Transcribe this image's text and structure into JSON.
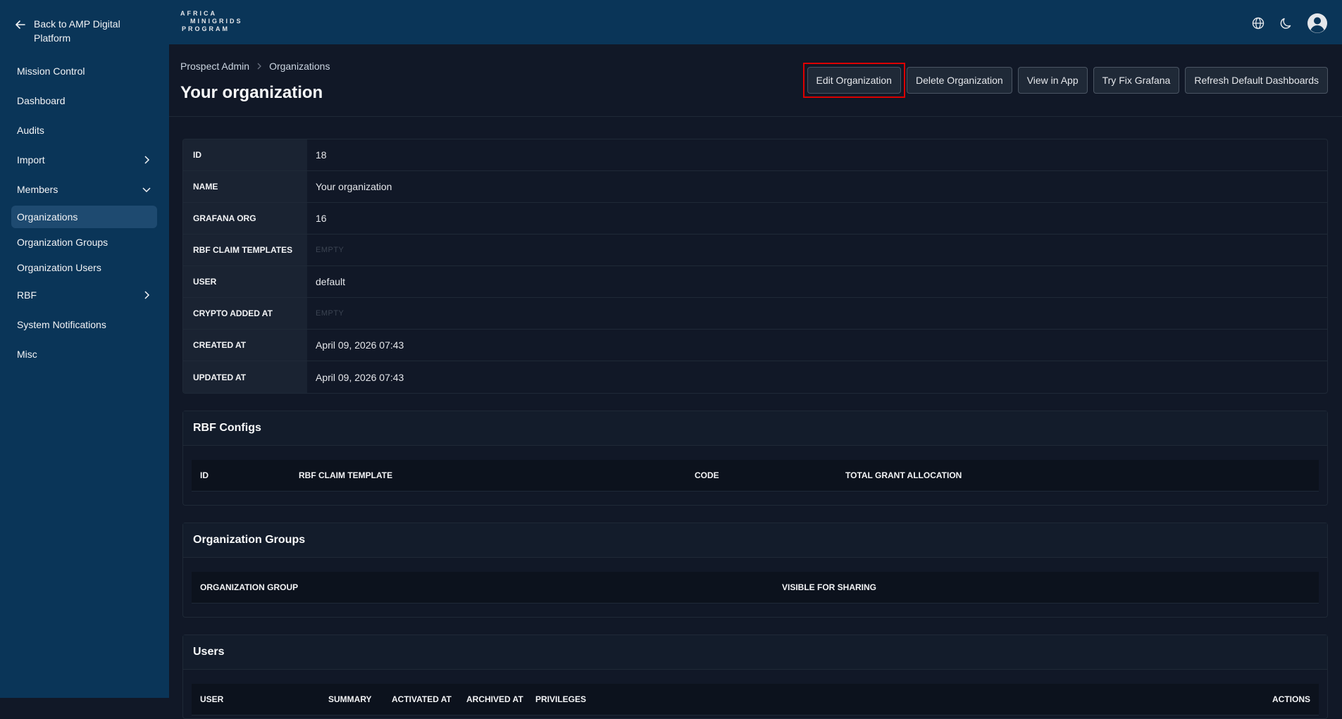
{
  "sidebar": {
    "back_label": "Back to AMP Digital Platform",
    "items": [
      {
        "label": "Mission Control",
        "chevron": "none"
      },
      {
        "label": "Dashboard",
        "chevron": "none"
      },
      {
        "label": "Audits",
        "chevron": "none"
      },
      {
        "label": "Import",
        "chevron": "right"
      },
      {
        "label": "Members",
        "chevron": "down"
      },
      {
        "label": "Organizations",
        "chevron": "none",
        "active": true
      },
      {
        "label": "Organization Groups",
        "chevron": "none"
      },
      {
        "label": "Organization Users",
        "chevron": "none"
      },
      {
        "label": "RBF",
        "chevron": "right"
      },
      {
        "label": "System Notifications",
        "chevron": "none"
      },
      {
        "label": "Misc",
        "chevron": "none"
      }
    ]
  },
  "logo": {
    "line1": "AFRICA",
    "line2": "MINIGRIDS",
    "line3": "PROGRAM"
  },
  "topbar": {
    "icons": [
      "globe-icon",
      "moon-icon",
      "user-avatar-icon"
    ]
  },
  "breadcrumb": {
    "root": "Prospect Admin",
    "current": "Organizations"
  },
  "page": {
    "title": "Your organization"
  },
  "actions": {
    "edit": "Edit Organization",
    "delete": "Delete Organization",
    "view": "View in App",
    "fix_grafana": "Try Fix Grafana",
    "refresh": "Refresh Default Dashboards"
  },
  "details": [
    {
      "key": "ID",
      "value": "18"
    },
    {
      "key": "NAME",
      "value": "Your organization"
    },
    {
      "key": "GRAFANA ORG",
      "value": "16"
    },
    {
      "key": "RBF CLAIM TEMPLATES",
      "value": "EMPTY",
      "empty": true
    },
    {
      "key": "USER",
      "value": "default"
    },
    {
      "key": "CRYPTO ADDED AT",
      "value": "EMPTY",
      "empty": true
    },
    {
      "key": "CREATED AT",
      "value": "April 09, 2026 07:43"
    },
    {
      "key": "UPDATED AT",
      "value": "April 09, 2026 07:43"
    }
  ],
  "rbf_configs": {
    "title": "RBF Configs",
    "columns": [
      "ID",
      "RBF CLAIM TEMPLATE",
      "CODE",
      "TOTAL GRANT ALLOCATION"
    ]
  },
  "org_groups": {
    "title": "Organization Groups",
    "columns": [
      "ORGANIZATION GROUP",
      "VISIBLE FOR SHARING"
    ]
  },
  "users": {
    "title": "Users",
    "columns": [
      "USER",
      "SUMMARY",
      "ACTIVATED AT",
      "ARCHIVED AT",
      "PRIVILEGES",
      "ACTIONS"
    ]
  },
  "colors": {
    "sidebar": "#0a3558",
    "background": "#111827",
    "highlight": "#dc0000"
  }
}
